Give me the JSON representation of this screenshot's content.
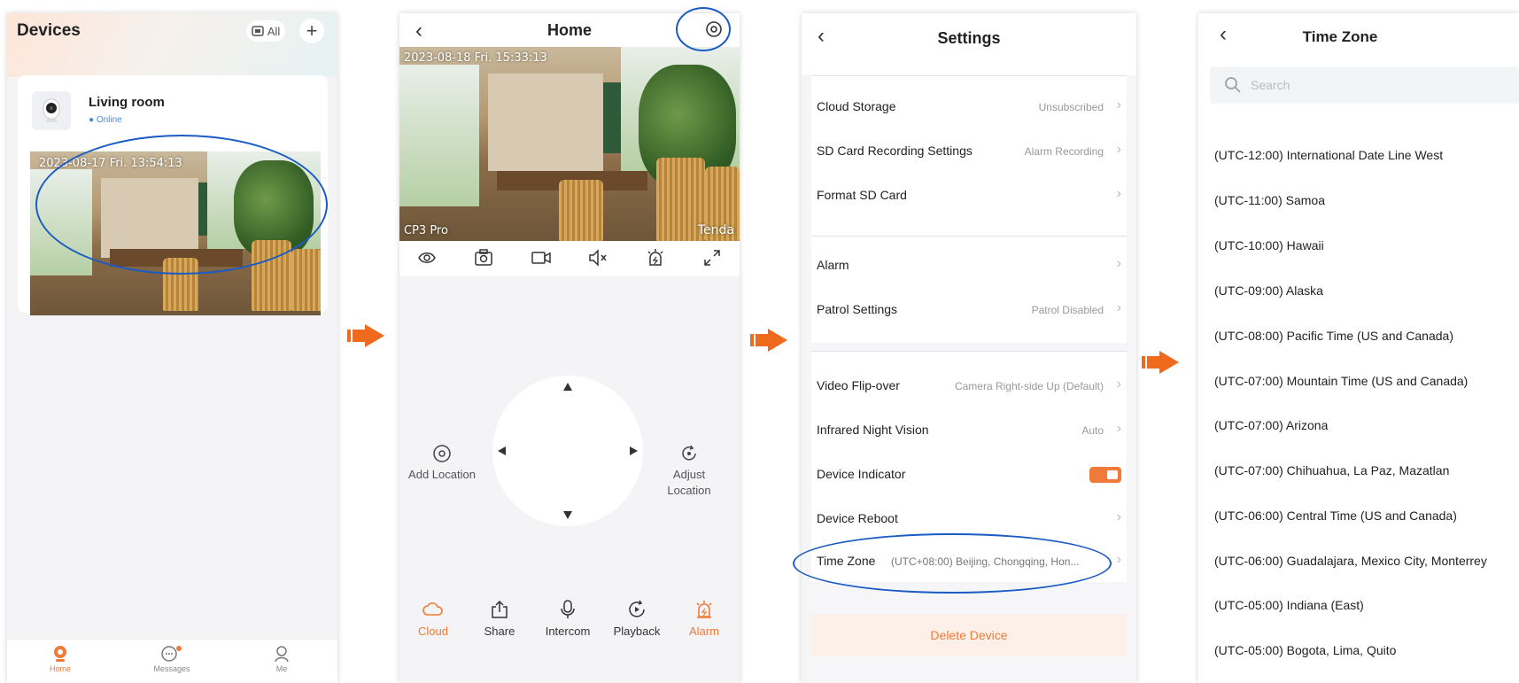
{
  "screen_devices": {
    "title": "Devices",
    "all_label": "All",
    "device": {
      "name": "Living room",
      "status": "Online",
      "timestamp": "2023-08-17 Fri.  13:54:13"
    },
    "tabs": [
      {
        "label": "Home",
        "icon": "home-icon"
      },
      {
        "label": "Messages",
        "icon": "messages-icon"
      },
      {
        "label": "Me",
        "icon": "me-icon"
      }
    ]
  },
  "screen_home": {
    "title": "Home",
    "timestamp": "2023-08-18  Fri.  15:33:13",
    "model_label": "CP3 Pro",
    "brand_label": "Tenda",
    "add_location": "Add Location",
    "adjust_location": "Adjust Location",
    "actions": [
      {
        "label": "Cloud",
        "icon": "cloud-icon"
      },
      {
        "label": "Share",
        "icon": "share-icon"
      },
      {
        "label": "Intercom",
        "icon": "microphone-icon"
      },
      {
        "label": "Playback",
        "icon": "playback-icon"
      },
      {
        "label": "Alarm",
        "icon": "alarm-icon"
      }
    ]
  },
  "screen_settings": {
    "title": "Settings",
    "cloud_storage": {
      "label": "Cloud Storage",
      "value": "Unsubscribed"
    },
    "sd_recording": {
      "label": "SD Card Recording Settings",
      "value": "Alarm Recording"
    },
    "format_sd": {
      "label": "Format SD Card"
    },
    "alarm": {
      "label": "Alarm"
    },
    "patrol": {
      "label": "Patrol Settings",
      "value": "Patrol Disabled"
    },
    "flip": {
      "label": "Video Flip-over",
      "value": "Camera Right-side Up (Default)"
    },
    "night_vision": {
      "label": "Infrared Night Vision",
      "value": "Auto"
    },
    "indicator": {
      "label": "Device Indicator"
    },
    "reboot": {
      "label": "Device Reboot"
    },
    "time_zone": {
      "label": "Time Zone",
      "value": "(UTC+08:00) Beijing, Chongqing, Hon..."
    },
    "delete_label": "Delete Device"
  },
  "screen_timezone": {
    "title": "Time Zone",
    "search_placeholder": "Search",
    "zones": [
      "(UTC-12:00) International Date Line West",
      "(UTC-11:00) Samoa",
      "(UTC-10:00) Hawaii",
      "(UTC-09:00) Alaska",
      "(UTC-08:00) Pacific Time (US and Canada)",
      "(UTC-07:00) Mountain Time (US and Canada)",
      "(UTC-07:00) Arizona",
      "(UTC-07:00) Chihuahua, La Paz, Mazatlan",
      "(UTC-06:00) Central Time (US and Canada)",
      "(UTC-06:00) Guadalajara, Mexico City, Monterrey",
      "(UTC-05:00) Indiana (East)",
      "(UTC-05:00) Bogota, Lima, Quito"
    ]
  },
  "colors": {
    "accent": "#f07a3a",
    "highlight": "#1a5bc4",
    "online": "#3b8ee8"
  }
}
